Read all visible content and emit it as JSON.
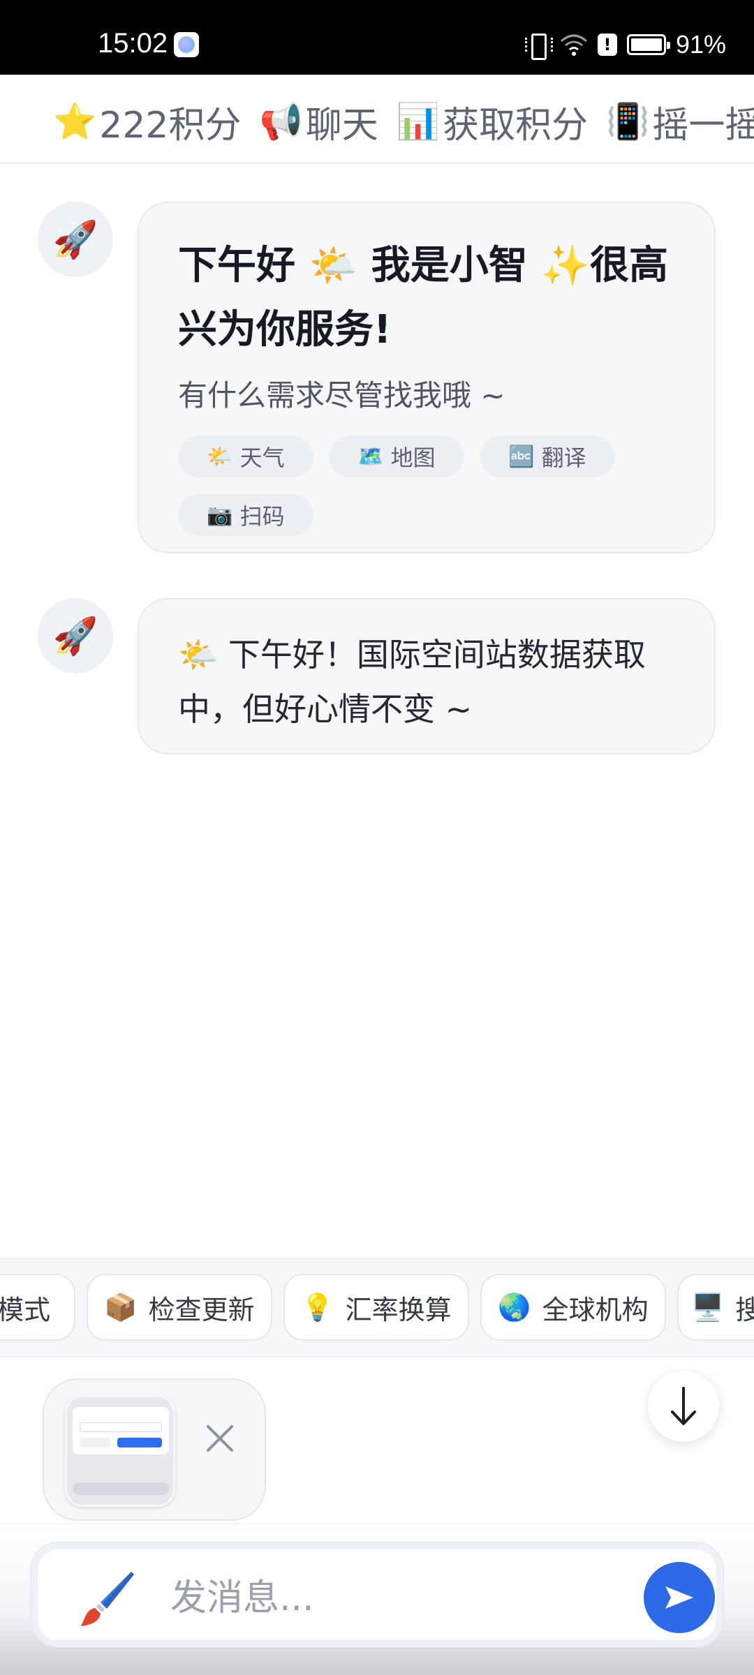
{
  "status_bar": {
    "time": "15:02",
    "battery_pct": "91%",
    "alert_glyph": "!"
  },
  "top_nav": {
    "items": [
      {
        "icon": "⭐",
        "label": "222积分"
      },
      {
        "icon": "📢",
        "label": "聊天"
      },
      {
        "icon": "📊",
        "label": "获取积分"
      },
      {
        "icon": "📳",
        "label": "摇一摇"
      }
    ]
  },
  "chat": {
    "avatar_icon": "🚀",
    "greeting": {
      "title": "下午好 🌤️ 我是小智 ✨很高兴为你服务!",
      "subtitle": "有什么需求尽管找我哦 ~",
      "chips": [
        {
          "icon": "🌤️",
          "label": "天气"
        },
        {
          "icon": "🗺️",
          "label": "地图"
        },
        {
          "icon": "🔤",
          "label": "翻译"
        },
        {
          "icon": "📷",
          "label": "扫码"
        }
      ]
    },
    "reply": {
      "text": "🌤️ 下午好！国际空间站数据获取中，但好心情不变 ~"
    }
  },
  "quick_actions": [
    {
      "icon": "",
      "label": "模式"
    },
    {
      "icon": "📦",
      "label": "检查更新"
    },
    {
      "icon": "💡",
      "label": "汇率换算"
    },
    {
      "icon": "🌏",
      "label": "全球机构"
    },
    {
      "icon": "🖥️",
      "label": "搜"
    }
  ],
  "composer": {
    "placeholder": "发消息...",
    "send_icon": "send-icon",
    "accent": "#2d6ae8"
  }
}
